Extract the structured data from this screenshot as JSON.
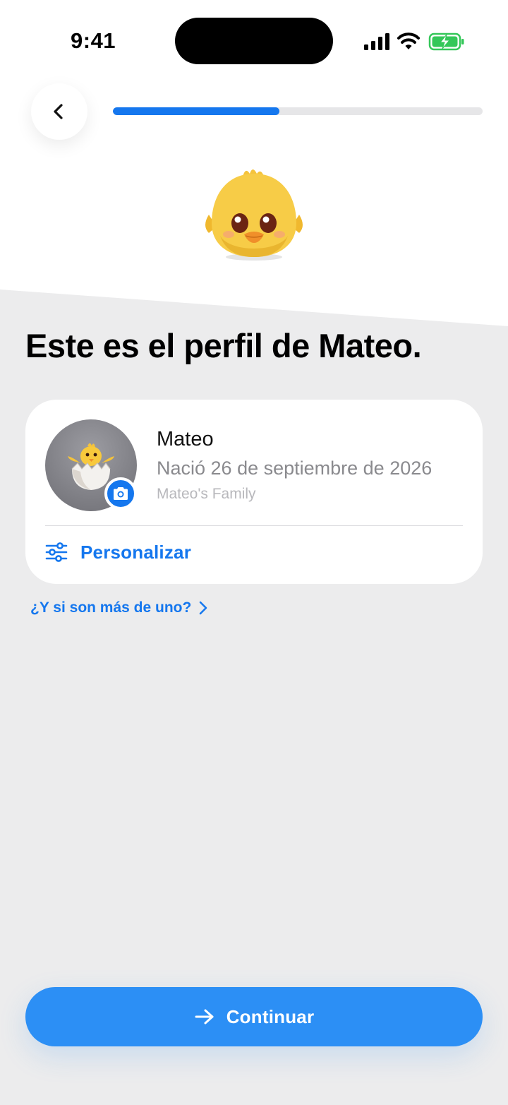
{
  "status_bar": {
    "time": "9:41"
  },
  "progress": {
    "value": 0.45
  },
  "title": "Este es el perfil de Mateo.",
  "profile": {
    "name": "Mateo",
    "birth": "Nació 26 de septiembre de 2026",
    "family": "Mateo's Family",
    "avatar_icon": "hatching-chick-icon",
    "customize_label": "Personalizar",
    "customize_icon": "sliders-icon"
  },
  "multiple_link": {
    "label": "¿Y si son más de uno?",
    "icon": "chevron-right-icon"
  },
  "continue_button": {
    "label": "Continuar",
    "icon": "arrow-right-icon"
  },
  "colors": {
    "accent": "#1577ee",
    "button": "#2c8ff5",
    "background": "#ececed"
  }
}
